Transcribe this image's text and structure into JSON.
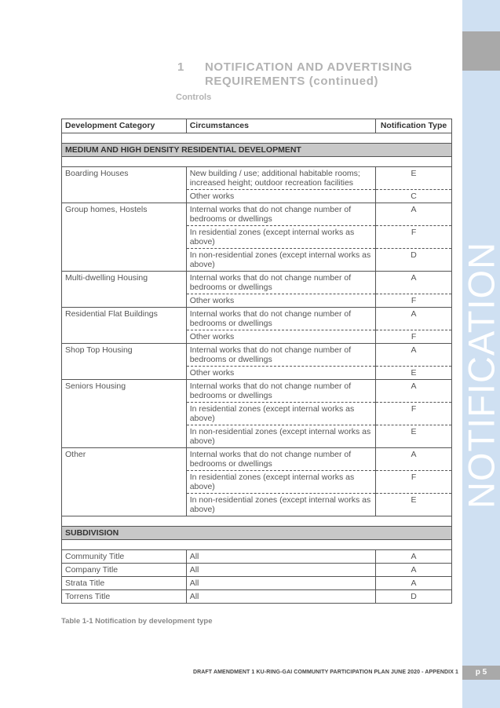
{
  "heading": {
    "number": "1",
    "line1": "NOTIFICATION AND ADVERTISING",
    "line2": "REQUIREMENTS (continued)",
    "subheading": "Controls"
  },
  "table": {
    "headers": [
      "Development Category",
      "Circumstances",
      "Notification Type"
    ],
    "sections": [
      {
        "title": "MEDIUM AND HIGH DENSITY RESIDENTIAL DEVELOPMENT",
        "groups": [
          {
            "category": "Boarding Houses",
            "rows": [
              {
                "circumstance": "New building / use; additional habitable rooms; increased height; outdoor recreation facilities",
                "type": "E"
              },
              {
                "circumstance": "Other works",
                "type": "C"
              }
            ]
          },
          {
            "category": "Group homes, Hostels",
            "rows": [
              {
                "circumstance": "Internal works that do not change number of bedrooms or dwellings",
                "type": "A"
              },
              {
                "circumstance": "In residential zones (except internal works as above)",
                "type": "F"
              },
              {
                "circumstance": "In non-residential zones (except internal works as above)",
                "type": "D"
              }
            ]
          },
          {
            "category": "Multi-dwelling Housing",
            "rows": [
              {
                "circumstance": "Internal works that do not change number of bedrooms or dwellings",
                "type": "A"
              },
              {
                "circumstance": "Other works",
                "type": "F"
              }
            ]
          },
          {
            "category": "Residential Flat Buildings",
            "rows": [
              {
                "circumstance": "Internal works that do not change number of bedrooms or dwellings",
                "type": "A"
              },
              {
                "circumstance": "Other works",
                "type": "F"
              }
            ]
          },
          {
            "category": "Shop Top Housing",
            "rows": [
              {
                "circumstance": "Internal works that do not change number of bedrooms or dwellings",
                "type": "A"
              },
              {
                "circumstance": "Other works",
                "type": "E"
              }
            ]
          },
          {
            "category": "Seniors Housing",
            "rows": [
              {
                "circumstance": "Internal works that do not change number of bedrooms or dwellings",
                "type": "A"
              },
              {
                "circumstance": "In residential zones (except internal works as above)",
                "type": "F"
              },
              {
                "circumstance": "In non-residential zones (except internal works as above)",
                "type": "E"
              }
            ]
          },
          {
            "category": "Other",
            "rows": [
              {
                "circumstance": "Internal works that do not change number of bedrooms or dwellings",
                "type": "A"
              },
              {
                "circumstance": "In residential zones (except internal works as above)",
                "type": "F"
              },
              {
                "circumstance": "In non-residential zones (except internal works as above)",
                "type": "E"
              }
            ]
          }
        ]
      },
      {
        "title": "SUBDIVISION",
        "groups": [
          {
            "category": "Community Title",
            "rows": [
              {
                "circumstance": "All",
                "type": "A"
              }
            ]
          },
          {
            "category": "Company Title",
            "rows": [
              {
                "circumstance": "All",
                "type": "A"
              }
            ]
          },
          {
            "category": "Strata Title",
            "rows": [
              {
                "circumstance": "All",
                "type": "A"
              }
            ]
          },
          {
            "category": "Torrens Title",
            "rows": [
              {
                "circumstance": "All",
                "type": "D"
              }
            ]
          }
        ]
      }
    ]
  },
  "caption": "Table 1-1 Notification by development type",
  "footer": "DRAFT AMENDMENT 1 KU-RING-GAI COMMUNITY PARTICIPATION PLAN JUNE 2020 - APPENDIX 1",
  "sidebar": {
    "vertical_title": "NOTIFICATION",
    "page_number": "p 5"
  },
  "colors": {
    "sidebar_blue": "#cfe0f2",
    "sidebar_grey": "#a9a9a9",
    "section_header_bg": "#c8c8c8",
    "heading_grey": "#b3b3b3"
  }
}
